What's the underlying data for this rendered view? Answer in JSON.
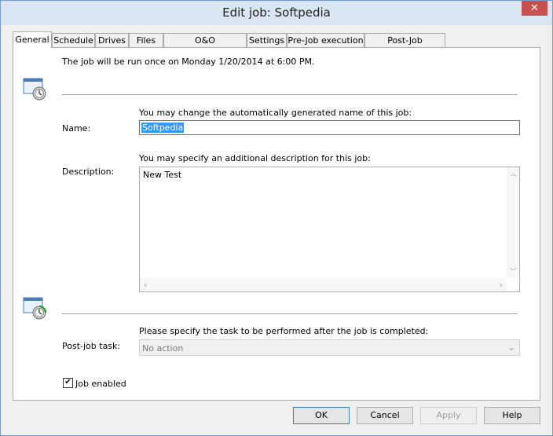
{
  "window": {
    "title": "Edit job: Softpedia",
    "close_glyph": "✕"
  },
  "tabs": [
    {
      "label": "General",
      "active": true
    },
    {
      "label": "Schedule"
    },
    {
      "label": "Drives"
    },
    {
      "label": "Files"
    },
    {
      "label": "O&O ActivityMonitor"
    },
    {
      "label": "Settings"
    },
    {
      "label": "Pre-Job execution"
    },
    {
      "label": "Post-Job execution"
    }
  ],
  "general": {
    "run_info": "The job will be run once on Monday 1/20/2014 at 6:00 PM.",
    "name_hint": "You may change the automatically generated name of this job:",
    "name_label": "Name:",
    "name_value": "Softpedia",
    "desc_hint": "You may specify an additional description for this job:",
    "desc_label": "Description:",
    "desc_value": "New Test",
    "post_hint": "Please specify the task to be performed after the job is completed:",
    "post_label": "Post-job task:",
    "post_value": "No action",
    "job_enabled_label": "Job enabled",
    "job_enabled": true
  },
  "buttons": {
    "ok": "OK",
    "cancel": "Cancel",
    "apply": "Apply",
    "help": "Help"
  },
  "icons": [
    "job-schedule-icon",
    "post-job-icon",
    "checkmark-icon",
    "dropdown-chevron-icon",
    "scroll-up-icon",
    "scroll-down-icon",
    "scroll-left-icon",
    "scroll-right-icon",
    "close-icon"
  ]
}
